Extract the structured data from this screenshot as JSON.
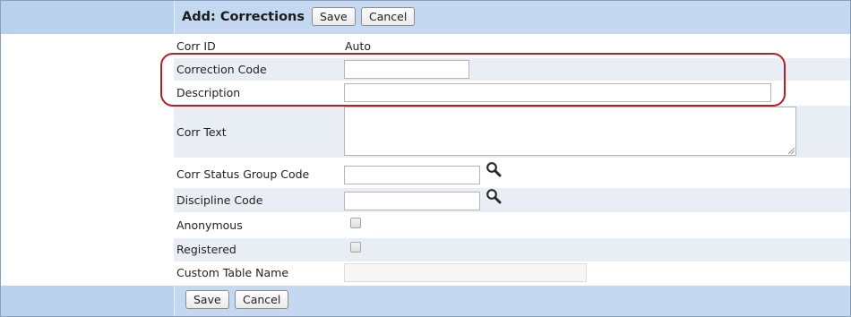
{
  "header": {
    "title": "Add: Corrections",
    "save_label": "Save",
    "cancel_label": "Cancel"
  },
  "footer": {
    "save_label": "Save",
    "cancel_label": "Cancel"
  },
  "fields": {
    "corr_id": {
      "label": "Corr ID",
      "value": "Auto"
    },
    "correction_code": {
      "label": "Correction Code",
      "value": ""
    },
    "description": {
      "label": "Description",
      "value": ""
    },
    "corr_text": {
      "label": "Corr Text",
      "value": ""
    },
    "corr_status_group_code": {
      "label": "Corr Status Group Code",
      "value": ""
    },
    "discipline_code": {
      "label": "Discipline Code",
      "value": ""
    },
    "anonymous": {
      "label": "Anonymous",
      "checked": false
    },
    "registered": {
      "label": "Registered",
      "checked": false
    },
    "custom_table_name": {
      "label": "Custom Table Name",
      "value": ""
    }
  },
  "icons": {
    "lookup": "magnifier-icon"
  },
  "colors": {
    "header_bar": "#b9d1ec",
    "row_shade": "#e9eef4",
    "highlight": "#b0202a"
  }
}
